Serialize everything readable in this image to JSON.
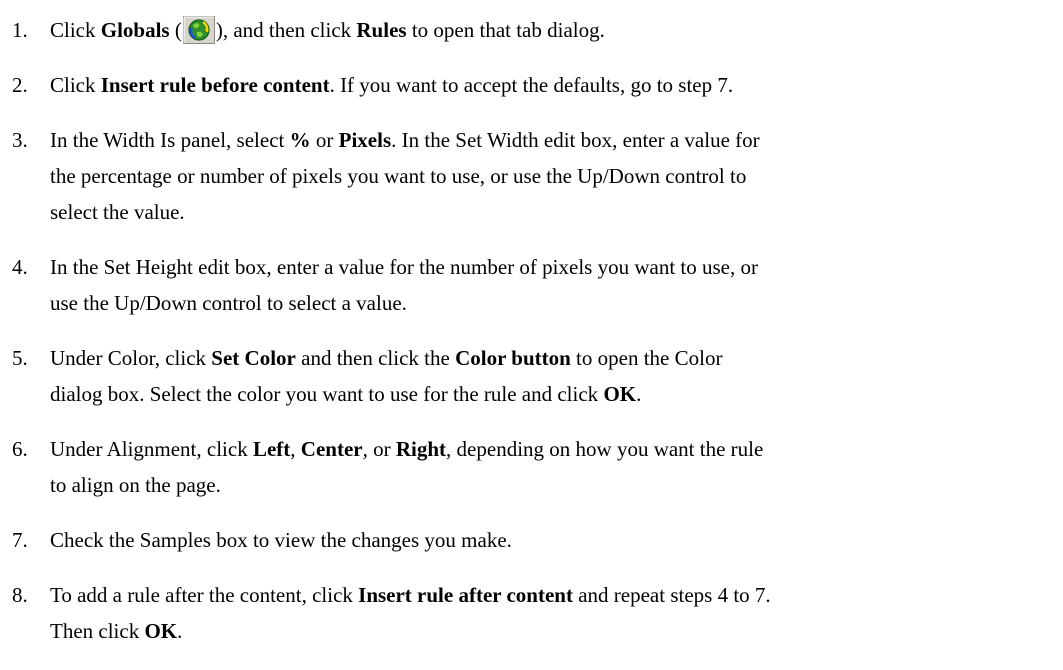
{
  "steps": [
    {
      "number": "1.",
      "parts": [
        {
          "t": "Click "
        },
        {
          "t": "Globals",
          "b": true
        },
        {
          "t": " ("
        },
        {
          "icon": "globals-icon"
        },
        {
          "t": "), and then click "
        },
        {
          "t": "Rules",
          "b": true
        },
        {
          "t": " to open that tab dialog."
        }
      ]
    },
    {
      "number": "2.",
      "parts": [
        {
          "t": "Click "
        },
        {
          "t": "Insert rule before content",
          "b": true
        },
        {
          "t": ". If you want to accept the defaults, go to step 7."
        }
      ]
    },
    {
      "number": "3.",
      "parts": [
        {
          "t": "In the Width Is panel, select "
        },
        {
          "t": "%",
          "b": true
        },
        {
          "t": " or "
        },
        {
          "t": "Pixels",
          "b": true
        },
        {
          "t": ". In the Set Width edit box, enter a value for"
        },
        {
          "br": true
        },
        {
          "t": "the percentage or number of pixels you want to use, or use the Up/Down control to"
        },
        {
          "br": true
        },
        {
          "t": "select the value."
        }
      ]
    },
    {
      "number": "4.",
      "parts": [
        {
          "t": "In the Set Height edit box, enter a value for the number of pixels you want to use, or"
        },
        {
          "br": true
        },
        {
          "t": "use the Up/Down control to select a value."
        }
      ]
    },
    {
      "number": "5.",
      "parts": [
        {
          "t": "Under Color, click "
        },
        {
          "t": "Set Color",
          "b": true
        },
        {
          "t": " and then click the "
        },
        {
          "t": "Color button",
          "b": true
        },
        {
          "t": " to open the Color"
        },
        {
          "br": true
        },
        {
          "t": "dialog box. Select the color you want to use for the rule and click "
        },
        {
          "t": "OK",
          "b": true
        },
        {
          "t": "."
        }
      ]
    },
    {
      "number": "6.",
      "parts": [
        {
          "t": "Under Alignment, click "
        },
        {
          "t": "Left",
          "b": true
        },
        {
          "t": ", "
        },
        {
          "t": "Center",
          "b": true
        },
        {
          "t": ", or "
        },
        {
          "t": "Right",
          "b": true
        },
        {
          "t": ", depending on how you want the rule"
        },
        {
          "br": true
        },
        {
          "t": "to align on the page."
        }
      ]
    },
    {
      "number": "7.",
      "parts": [
        {
          "t": "Check the Samples box to view the changes you make."
        }
      ]
    },
    {
      "number": "8.",
      "parts": [
        {
          "t": "To add a rule after the content, click "
        },
        {
          "t": "Insert rule after content",
          "b": true
        },
        {
          "t": " and repeat steps 4 to 7."
        },
        {
          "br": true
        },
        {
          "t": "Then click "
        },
        {
          "t": "OK",
          "b": true
        },
        {
          "t": "."
        }
      ]
    }
  ]
}
